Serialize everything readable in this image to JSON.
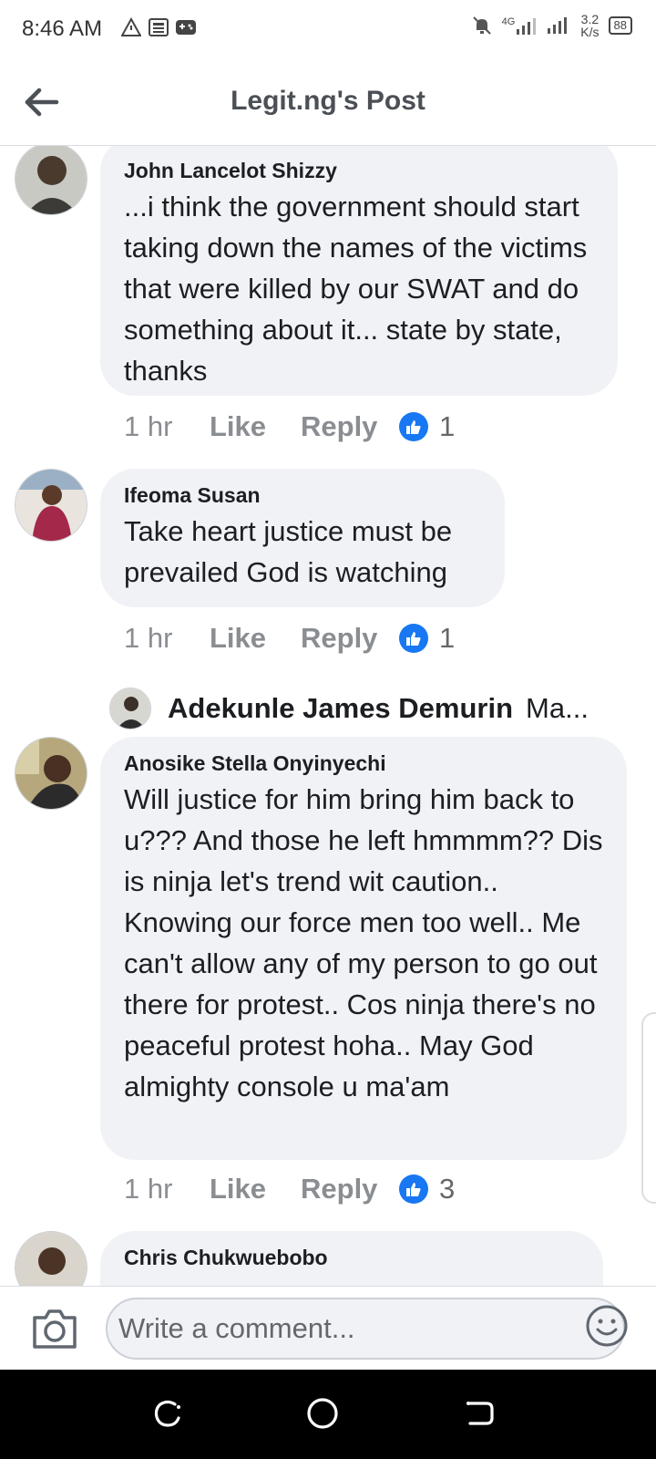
{
  "status_bar": {
    "time": "8:46 AM",
    "network": "4G",
    "speed_value": "3.2",
    "speed_unit": "K/s",
    "battery": "88"
  },
  "header": {
    "title": "Legit.ng's Post"
  },
  "comments": [
    {
      "author": "John Lancelot Shizzy",
      "text": "...i think the government should start taking down the names of the victims that were killed by our SWAT and do something about it... state by state, thanks",
      "time": "1 hr",
      "like_label": "Like",
      "reply_label": "Reply",
      "likes": "1"
    },
    {
      "author": "Ifeoma Susan",
      "text": "Take heart justice must be prevailed God is watching",
      "time": "1 hr",
      "like_label": "Like",
      "reply_label": "Reply",
      "likes": "1"
    },
    {
      "author": "Anosike Stella Onyinyechi",
      "text": "Will justice for him bring him back to u??? And those he left hmmmm?? Dis is ninja let's trend wit caution.. Knowing our force men too well.. Me can't allow any of my person to go out there for protest.. Cos ninja there's no peaceful protest hoha.. May God almighty console u ma'am",
      "time": "1 hr",
      "like_label": "Like",
      "reply_label": "Reply",
      "likes": "3"
    },
    {
      "author": "Chris Chukwuebobo",
      "text": ""
    }
  ],
  "reply_preview": {
    "name": "Adekunle James Demurin",
    "snippet": "Ma..."
  },
  "composer": {
    "placeholder": "Write a comment..."
  },
  "colors": {
    "bubble": "#f0f2f5",
    "like_blue": "#1877f2",
    "muted_text": "#8a8d91"
  }
}
